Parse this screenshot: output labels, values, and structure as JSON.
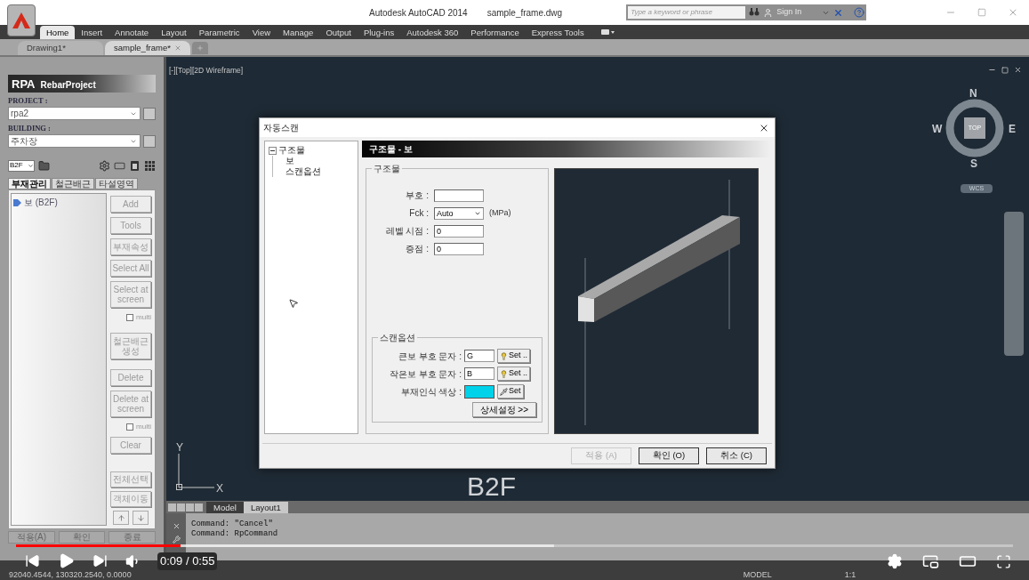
{
  "window": {
    "title": "Autodesk AutoCAD 2014",
    "file": "sample_frame.dwg"
  },
  "search": {
    "placeholder": "Type a keyword or phrase"
  },
  "sign_in": "Sign In",
  "ribbon_tabs": [
    {
      "label": "Home",
      "selected": true
    },
    {
      "label": "Insert",
      "selected": false
    },
    {
      "label": "Annotate",
      "selected": false
    },
    {
      "label": "Layout",
      "selected": false
    },
    {
      "label": "Parametric",
      "selected": false
    },
    {
      "label": "View",
      "selected": false
    },
    {
      "label": "Manage",
      "selected": false
    },
    {
      "label": "Output",
      "selected": false
    },
    {
      "label": "Plug-ins",
      "selected": false
    },
    {
      "label": "Autodesk 360",
      "selected": false
    },
    {
      "label": "Performance",
      "selected": false
    },
    {
      "label": "Express Tools",
      "selected": false
    }
  ],
  "doc_tabs": [
    {
      "label": "Drawing1*",
      "selected": false
    },
    {
      "label": "sample_frame*",
      "selected": true
    }
  ],
  "rebar_panel": {
    "logo": "RPA",
    "title": "RebarProject",
    "fields": [
      {
        "label": "PROJECT :",
        "value": "rpa2"
      },
      {
        "label": "BUILDING :",
        "value": "주차장"
      }
    ],
    "floor": "B2F",
    "tabs": [
      {
        "label": "부재관리",
        "selected": true
      },
      {
        "label": "철근배근",
        "selected": false
      },
      {
        "label": "타설영역",
        "selected": false
      }
    ],
    "tree": [
      {
        "label": "보 (B2F)"
      }
    ],
    "actions": [
      {
        "kind": "button",
        "label": "Add"
      },
      {
        "kind": "button",
        "label": "Tools"
      },
      {
        "kind": "button",
        "label": "부재속성"
      },
      {
        "kind": "button",
        "label": "Select All"
      },
      {
        "kind": "button",
        "label": "Select at screen"
      },
      {
        "kind": "checkbox",
        "label": "multi",
        "checked": false
      },
      {
        "kind": "button",
        "label": "철근배근 생성"
      },
      {
        "kind": "button",
        "label": "Delete"
      },
      {
        "kind": "button",
        "label": "Delete at screen"
      },
      {
        "kind": "checkbox",
        "label": "multi",
        "checked": false
      },
      {
        "kind": "button",
        "label": "Clear"
      }
    ],
    "lower_actions": [
      "전체선택",
      "객체이동"
    ],
    "footer_buttons": [
      "적용(A)",
      "확인",
      "종료"
    ]
  },
  "viewport": {
    "view_label": "[-][Top][2D Wireframe]",
    "compass": {
      "north": "N",
      "east": "E",
      "south": "S",
      "west": "W",
      "face": "TOP"
    },
    "ucs_name": "WCS",
    "floor_text": "B2F",
    "axes": {
      "x": "X",
      "y": "Y"
    },
    "layout_tabs": [
      {
        "label": "Model",
        "selected": true
      },
      {
        "label": "Layout1",
        "selected": false
      }
    ]
  },
  "dialog": {
    "title": "자동스캔",
    "tree": [
      {
        "label": "구조물",
        "expanded": true,
        "children": [
          {
            "label": "보"
          },
          {
            "label": "스캔옵션"
          }
        ]
      }
    ],
    "header": "구조물 - 보",
    "group": {
      "title": "구조물",
      "fields": [
        {
          "kind": "text",
          "label": "부호 :"
        },
        {
          "kind": "select",
          "label": "Fck :",
          "value": "Auto",
          "unit": "(MPa)"
        },
        {
          "kind": "text",
          "label": "레벨 시점 :",
          "value": "0"
        },
        {
          "kind": "text",
          "label": "증점 :",
          "value": "0"
        }
      ]
    },
    "scan_options": {
      "title": "스캔옵션",
      "rows": [
        {
          "kind": "text",
          "label": "큰보 부호 문자 :",
          "value": "G",
          "button": "Set .."
        },
        {
          "kind": "text",
          "label": "작은보 부호 문자 :",
          "value": "B",
          "button": "Set .."
        },
        {
          "kind": "color",
          "label": "부재인식 색상 :",
          "color": "#00d2ea",
          "button": "Set"
        }
      ],
      "more": "상세설정 >>"
    },
    "buttons": [
      {
        "label": "적용 (A)",
        "disabled": true
      },
      {
        "label": "확인 (O)",
        "disabled": false
      },
      {
        "label": "취소 (C)",
        "disabled": false
      }
    ]
  },
  "command": {
    "history": [
      "Command: \"Cancel\"",
      "Command: RpCommand"
    ]
  },
  "status_bar": {
    "coordinates": "92040.4544, 130320.2540, 0.0000",
    "mode": "MODEL",
    "scale": "1:1"
  },
  "player": {
    "played": {
      "level": 0.165
    },
    "buffered": {
      "level": 0.54
    },
    "time": "0:09 / 0:55"
  }
}
